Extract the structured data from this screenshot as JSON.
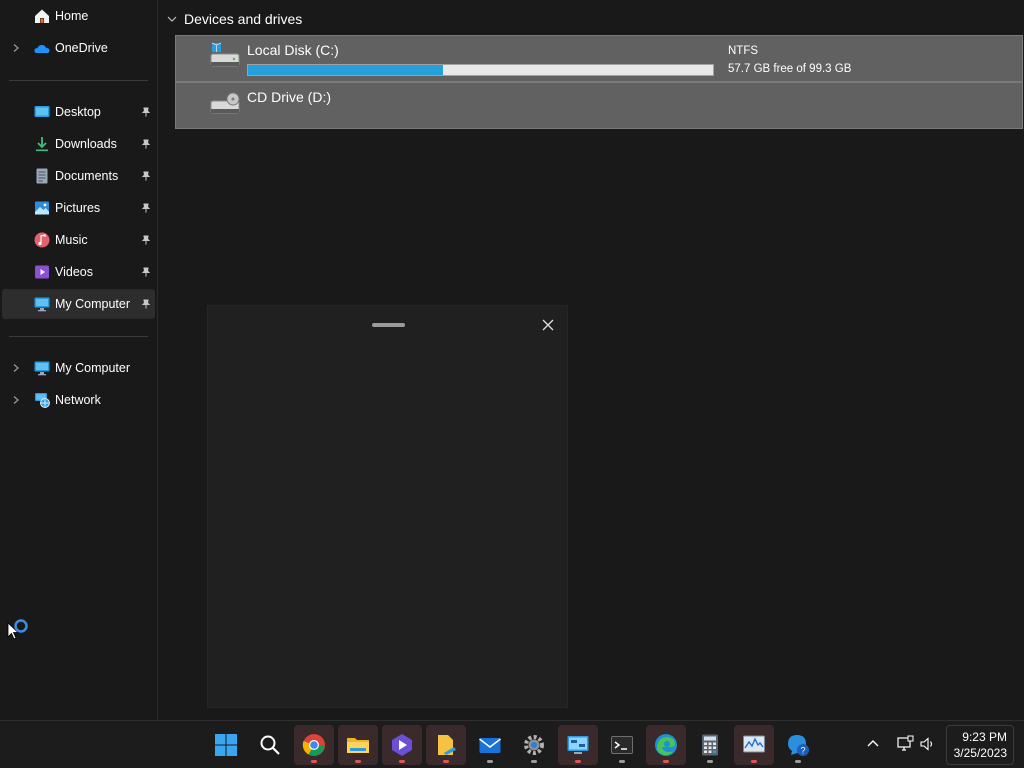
{
  "sidebar": {
    "top_items": [
      {
        "label": "Home",
        "icon": "home-icon"
      },
      {
        "label": "OneDrive",
        "icon": "onedrive-icon"
      }
    ],
    "quick_access": [
      {
        "label": "Desktop",
        "icon": "desktop-icon",
        "pinned": true
      },
      {
        "label": "Downloads",
        "icon": "downloads-icon",
        "pinned": true
      },
      {
        "label": "Documents",
        "icon": "documents-icon",
        "pinned": true
      },
      {
        "label": "Pictures",
        "icon": "pictures-icon",
        "pinned": true
      },
      {
        "label": "Music",
        "icon": "music-icon",
        "pinned": true
      },
      {
        "label": "Videos",
        "icon": "videos-icon",
        "pinned": true
      },
      {
        "label": "My Computer",
        "icon": "computer-icon",
        "pinned": true,
        "selected": true
      }
    ],
    "bottom_items": [
      {
        "label": "My Computer",
        "icon": "computer-icon"
      },
      {
        "label": "Network",
        "icon": "network-icon"
      }
    ]
  },
  "content": {
    "group_title": "Devices and drives",
    "drives": [
      {
        "name": "Local Disk (C:)",
        "filesystem": "NTFS",
        "free_text": "57.7 GB free of 99.3 GB",
        "used_fraction": 0.419,
        "icon": "hard-drive-icon"
      },
      {
        "name": "CD Drive (D:)",
        "icon": "cd-drive-icon"
      }
    ]
  },
  "taskbar": {
    "apps": [
      {
        "name": "start",
        "icon": "windows-start-icon"
      },
      {
        "name": "search",
        "icon": "search-icon"
      },
      {
        "name": "chrome",
        "icon": "chrome-icon",
        "open": true
      },
      {
        "name": "file-explorer",
        "icon": "folder-icon",
        "open": true
      },
      {
        "name": "clipchamp",
        "icon": "clipchamp-icon",
        "open": true
      },
      {
        "name": "app-installer",
        "icon": "file-edit-icon",
        "open": true
      },
      {
        "name": "mail",
        "icon": "mail-icon"
      },
      {
        "name": "settings",
        "icon": "settings-gear-icon"
      },
      {
        "name": "control-panel",
        "icon": "control-panel-icon",
        "open": true
      },
      {
        "name": "terminal",
        "icon": "terminal-icon"
      },
      {
        "name": "edge",
        "icon": "edge-icon",
        "open": true
      },
      {
        "name": "calculator",
        "icon": "calculator-icon"
      },
      {
        "name": "performance-monitor",
        "icon": "performance-monitor-icon",
        "open": true
      },
      {
        "name": "get-help",
        "icon": "help-icon"
      }
    ],
    "tray": {
      "icons": [
        "chevron-up-icon",
        "network-status-icon",
        "volume-icon"
      ],
      "time": "9:23 PM",
      "date": "3/25/2023"
    }
  },
  "colors": {
    "accent": "#26a0da",
    "selected_row": "#616161",
    "background": "#191919"
  }
}
